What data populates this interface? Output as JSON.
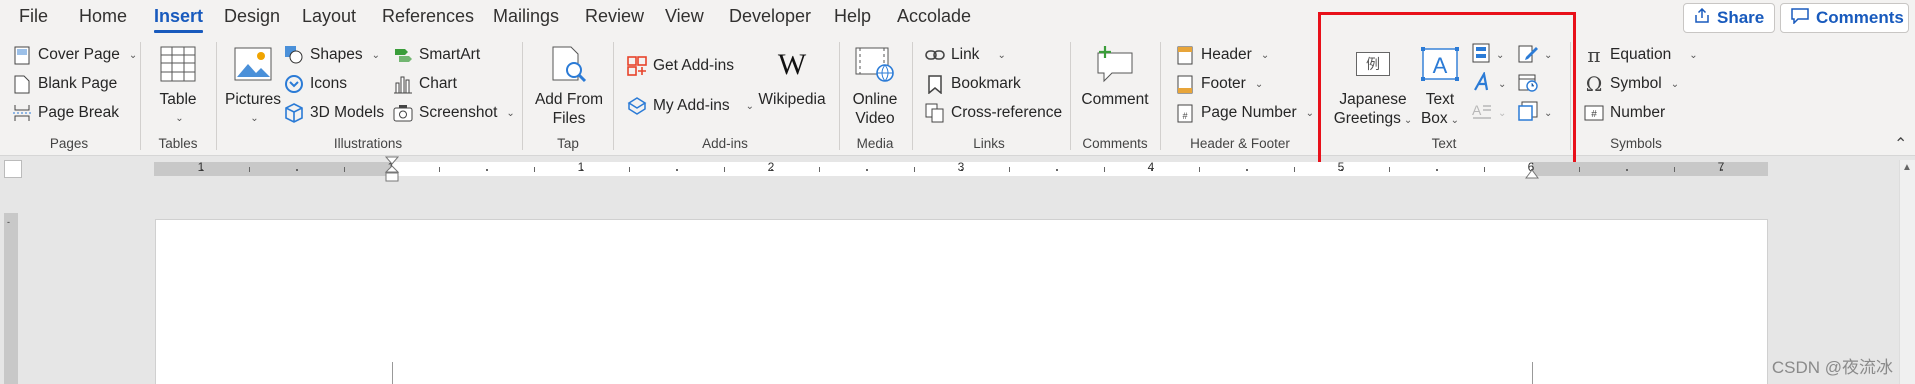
{
  "tabs": [
    "File",
    "Home",
    "Insert",
    "Design",
    "Layout",
    "References",
    "Mailings",
    "Review",
    "View",
    "Developer",
    "Help",
    "Accolade"
  ],
  "active_tab": "Insert",
  "top_buttons": {
    "share": "Share",
    "comments": "Comments"
  },
  "groups": {
    "pages": {
      "label": "Pages",
      "cover_page": "Cover Page",
      "blank_page": "Blank Page",
      "page_break": "Page Break"
    },
    "tables": {
      "label": "Tables",
      "table": "Table"
    },
    "illustrations": {
      "label": "Illustrations",
      "pictures": "Pictures",
      "shapes": "Shapes",
      "icons": "Icons",
      "models_3d": "3D Models",
      "smartart": "SmartArt",
      "chart": "Chart",
      "screenshot": "Screenshot"
    },
    "tap": {
      "label": "Tap",
      "add_from_files_line1": "Add From",
      "add_from_files_line2": "Files"
    },
    "addins": {
      "label": "Add-ins",
      "get_addins": "Get Add-ins",
      "my_addins": "My Add-ins",
      "wikipedia": "Wikipedia"
    },
    "media": {
      "label": "Media",
      "online_video_line1": "Online",
      "online_video_line2": "Video"
    },
    "links": {
      "label": "Links",
      "link": "Link",
      "bookmark": "Bookmark",
      "cross_reference": "Cross-reference"
    },
    "comments": {
      "label": "Comments",
      "comment": "Comment"
    },
    "header_footer": {
      "label": "Header & Footer",
      "header": "Header",
      "footer": "Footer",
      "page_number": "Page Number"
    },
    "text": {
      "label": "Text",
      "japanese_greetings_line1": "Japanese",
      "japanese_greetings_line2": "Greetings",
      "text_box_line1": "Text",
      "text_box_line2": "Box",
      "jp_glyph": "例"
    },
    "symbols": {
      "label": "Symbols",
      "equation": "Equation",
      "symbol": "Symbol",
      "number": "Number"
    }
  },
  "ruler_numbers": [
    "1",
    "1",
    "1",
    "2",
    "3",
    "4",
    "5",
    "6",
    "7"
  ],
  "watermark": "CSDN @夜流冰",
  "colors": {
    "accent": "#185abd",
    "highlight": "#e8101a",
    "ribbon_bg": "#f3f2f1"
  }
}
